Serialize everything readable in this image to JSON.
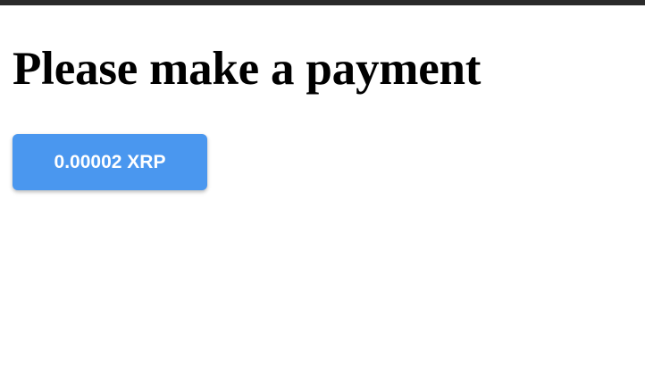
{
  "page": {
    "title": "Please make a payment"
  },
  "payment": {
    "button_label": "0.00002 XRP",
    "button_color": "#4a97ef"
  }
}
